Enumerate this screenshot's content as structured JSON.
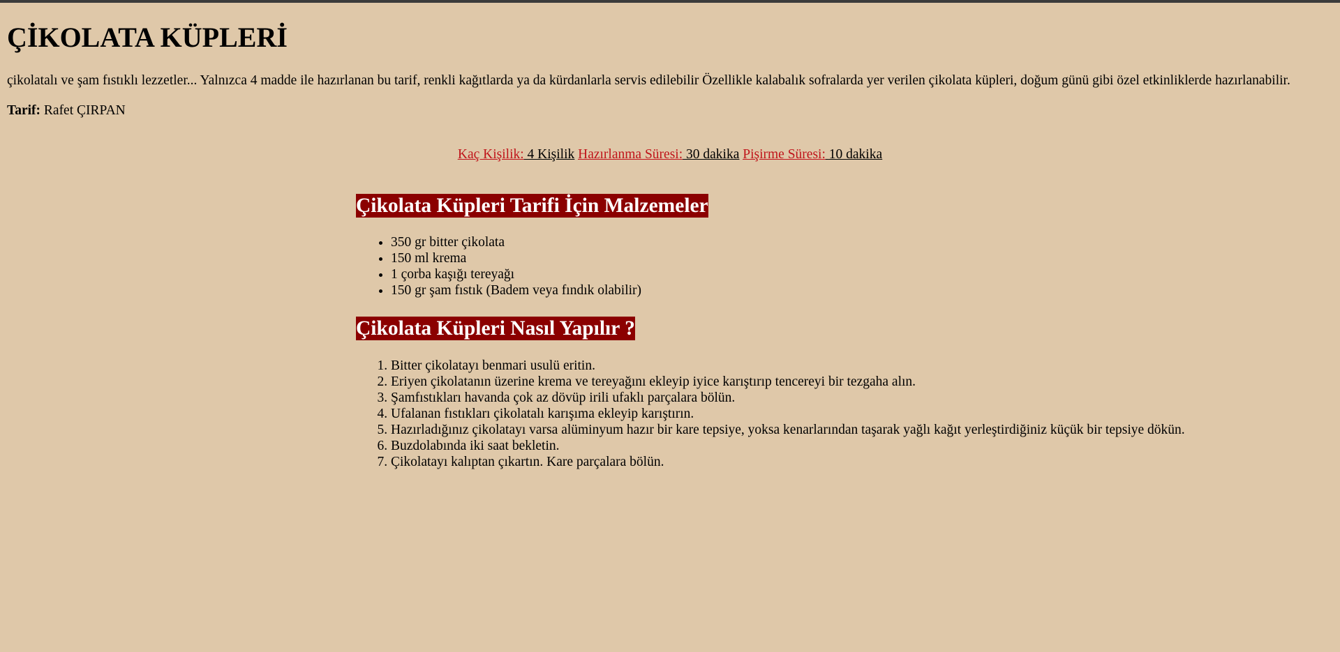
{
  "page": {
    "title": "ÇİKOLATA KÜPLERİ",
    "intro": "çikolatalı ve şam fıstıklı lezzetler... Yalnızca 4 madde ile hazırlanan bu tarif, renkli kağıtlarda ya da kürdanlarla servis edilebilir Özellikle kalabalık sofralarda yer verilen çikolata küpleri, doğum günü gibi özel etkinliklerde hazırlanabilir.",
    "author_label": "Tarif:",
    "author_name": "Rafet ÇIRPAN"
  },
  "meta": {
    "servings_label": "Kaç Kişilik:",
    "servings_value": "4 Kişilik",
    "prep_label": "Hazırlanma Süresi:",
    "prep_value": "30 dakika",
    "cook_label": "Pişirme Süresi:",
    "cook_value": "10 dakika"
  },
  "ingredients": {
    "heading": "Çikolata Küpleri Tarifi İçin Malzemeler",
    "items": [
      "350 gr bitter çikolata",
      "150 ml krema",
      "1 çorba kaşığı tereyağı",
      "150 gr şam fıstık (Badem veya fındık olabilir)"
    ]
  },
  "steps": {
    "heading": "Çikolata Küpleri Nasıl Yapılır ?",
    "items": [
      "Bitter çikolatayı benmari usulü eritin.",
      "Eriyen çikolatanın üzerine krema ve tereyağını ekleyip iyice karıştırıp tencereyi bir tezgaha alın.",
      "Şamfıstıkları havanda çok az dövüp irili ufaklı parçalara bölün.",
      "Ufalanan fıstıkları çikolatalı karışıma ekleyip karıştırın.",
      "Hazırladığınız çikolatayı varsa alüminyum hazır bir kare tepsiye, yoksa kenarlarından taşarak yağlı kağıt yerleştirdiğiniz küçük bir tepsiye dökün.",
      "Buzdolabında iki saat bekletin.",
      "Çikolatayı kalıptan çıkartın. Kare parçalara bölün."
    ]
  },
  "colors": {
    "background": "#dfc8a9",
    "heading_band": "#8b0000",
    "meta_label": "#c0141a"
  }
}
